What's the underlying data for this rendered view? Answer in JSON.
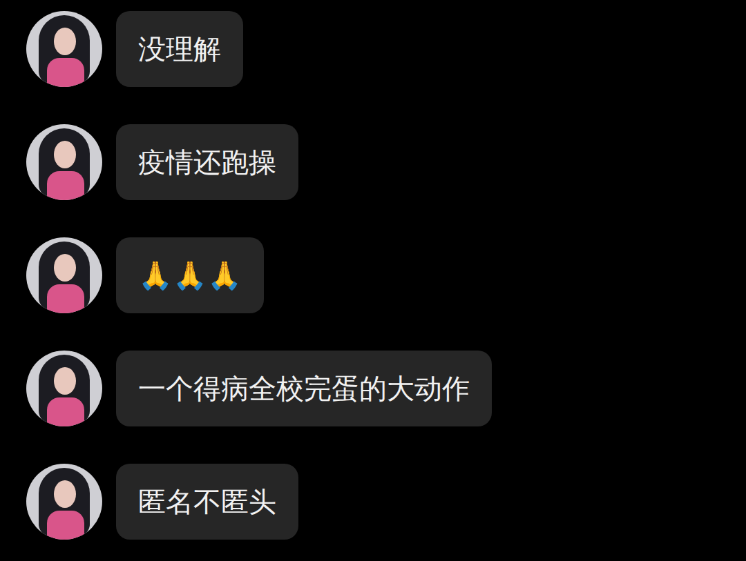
{
  "messages": [
    {
      "text": "没理解"
    },
    {
      "text": "疫情还跑操"
    },
    {
      "text": "🙏🙏🙏"
    },
    {
      "text": "一个得病全校完蛋的大动作"
    },
    {
      "text": "匿名不匿头"
    }
  ]
}
